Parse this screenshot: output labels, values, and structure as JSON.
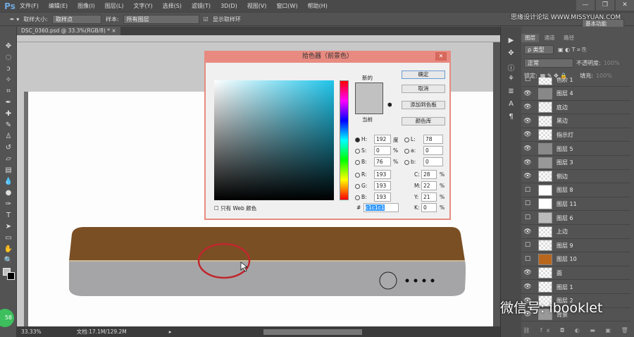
{
  "app": {
    "logo": "Ps"
  },
  "menu": [
    "文件(F)",
    "编辑(E)",
    "图像(I)",
    "图层(L)",
    "文字(Y)",
    "选择(S)",
    "滤镜(T)",
    "3D(D)",
    "视图(V)",
    "窗口(W)",
    "帮助(H)"
  ],
  "window_controls": {
    "minimize": "—",
    "restore": "❐",
    "close": "✕"
  },
  "watermark_top": "思缘设计论坛 WWW.MISSYUAN.COM",
  "options": {
    "sample_size_label": "取样大小:",
    "sample_size_value": "取样点",
    "sample_label": "样本:",
    "sample_value": "所有图层",
    "show_ring_label": "显示取样环",
    "show_ring_checked": true,
    "workspace": "基本功能"
  },
  "document_tab": {
    "title": "DSC_0360.psd @ 33.3%(RGB/8) *",
    "close": "×"
  },
  "status": {
    "zoom": "33.33%",
    "doc": "文档:17.1M/129.2M"
  },
  "badge": "58",
  "dialog": {
    "title": "拾色器（前景色）",
    "close": "✕",
    "new_label": "新的",
    "current_label": "当前",
    "new_color": "#c1c1c1",
    "current_color": "#c1c1c1",
    "buttons": {
      "ok": "确定",
      "cancel": "取消",
      "add_swatch": "添加到色板",
      "libraries": "颜色库"
    },
    "fields": {
      "H": {
        "label": "H:",
        "value": "192",
        "unit": "度",
        "selected": true
      },
      "S": {
        "label": "S:",
        "value": "0",
        "unit": "%"
      },
      "B": {
        "label": "B:",
        "value": "76",
        "unit": "%"
      },
      "R": {
        "label": "R:",
        "value": "193"
      },
      "G": {
        "label": "G:",
        "value": "193"
      },
      "Bl": {
        "label": "B:",
        "value": "193"
      },
      "L": {
        "label": "L:",
        "value": "78"
      },
      "a": {
        "label": "a:",
        "value": "0"
      },
      "b": {
        "label": "b:",
        "value": "0"
      },
      "C": {
        "label": "C:",
        "value": "28",
        "unit": "%"
      },
      "M": {
        "label": "M:",
        "value": "22",
        "unit": "%"
      },
      "Y": {
        "label": "Y:",
        "value": "21",
        "unit": "%"
      },
      "K": {
        "label": "K:",
        "value": "0",
        "unit": "%"
      }
    },
    "hex_label": "#",
    "hex": "c1c1c1",
    "web_only_label": "只有 Web 颜色"
  },
  "layers_panel": {
    "tabs": [
      "图层",
      "通道",
      "路径"
    ],
    "filter": "ρ 类型",
    "blend_mode": "正常",
    "opacity_label": "不透明度:",
    "opacity": "100%",
    "lock_label": "锁定:",
    "fill_label": "填充:",
    "fill": "100%",
    "layers": [
      {
        "name": "色阶 1",
        "visible": false
      },
      {
        "name": "图层 4",
        "visible": true
      },
      {
        "name": "底边",
        "visible": true
      },
      {
        "name": "黑边",
        "visible": true
      },
      {
        "name": "指示灯",
        "visible": true
      },
      {
        "name": "图层 5",
        "visible": true
      },
      {
        "name": "图层 3",
        "visible": true
      },
      {
        "name": "侧边",
        "visible": true
      },
      {
        "name": "图层 8",
        "visible": false
      },
      {
        "name": "图层 11",
        "visible": false
      },
      {
        "name": "图层 6",
        "visible": false
      },
      {
        "name": "上边",
        "visible": true
      },
      {
        "name": "图层 9",
        "visible": false
      },
      {
        "name": "图层 10",
        "visible": false
      },
      {
        "name": "面",
        "visible": true
      },
      {
        "name": "图层 1",
        "visible": true
      },
      {
        "name": "图层 2",
        "visible": true
      },
      {
        "name": "背景",
        "visible": true
      }
    ]
  },
  "watermark_bottom": "微信号: ibooklet"
}
